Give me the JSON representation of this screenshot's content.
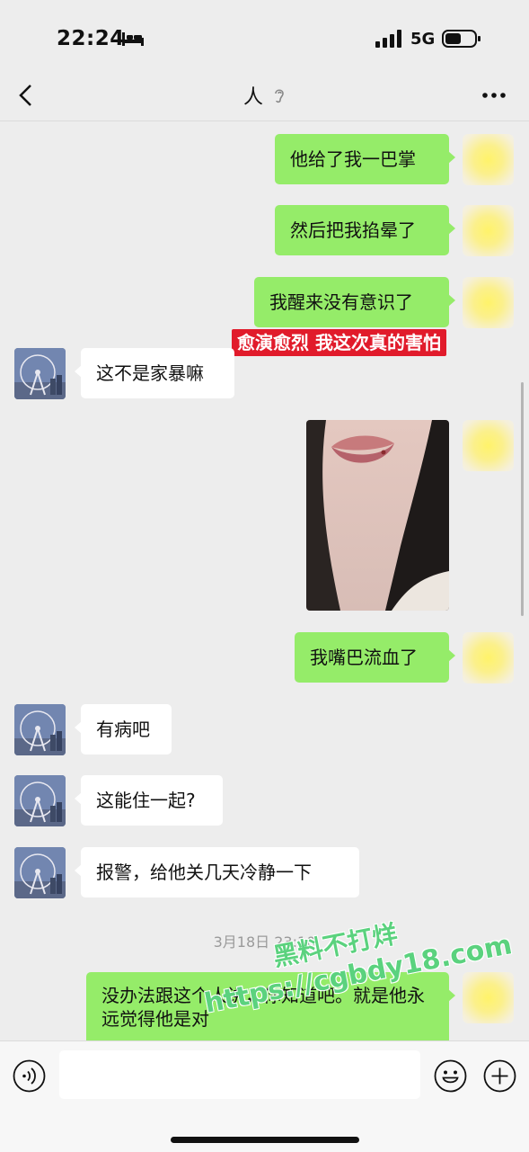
{
  "status_bar": {
    "time": "22:24",
    "network": "5G"
  },
  "header": {
    "title": "人"
  },
  "messages": [
    {
      "side": "me",
      "text": "他给了我一巴掌"
    },
    {
      "side": "me",
      "text": "然后把我掐晕了"
    },
    {
      "side": "me",
      "text": "我醒来没有意识了"
    },
    {
      "side": "them",
      "text": "这不是家暴嘛"
    },
    {
      "side": "me",
      "type": "image",
      "text": ""
    },
    {
      "side": "me",
      "text": "我嘴巴流血了"
    },
    {
      "side": "them",
      "text": "有病吧"
    },
    {
      "side": "them",
      "text": "这能住一起?"
    },
    {
      "side": "them",
      "text": "报警，给他关几天冷静一下"
    },
    {
      "side": "me",
      "text": "没办法跟这个人讲，你知道吧。就是他永远觉得他是对"
    }
  ],
  "overlay_caption": "愈演愈烈 我这次真的害怕",
  "timestamp": "3月18日 23:10",
  "watermark": {
    "line1": "黑料不打烊",
    "line2": "https://cgbdy18.com"
  },
  "input": {
    "value": "",
    "placeholder": ""
  }
}
